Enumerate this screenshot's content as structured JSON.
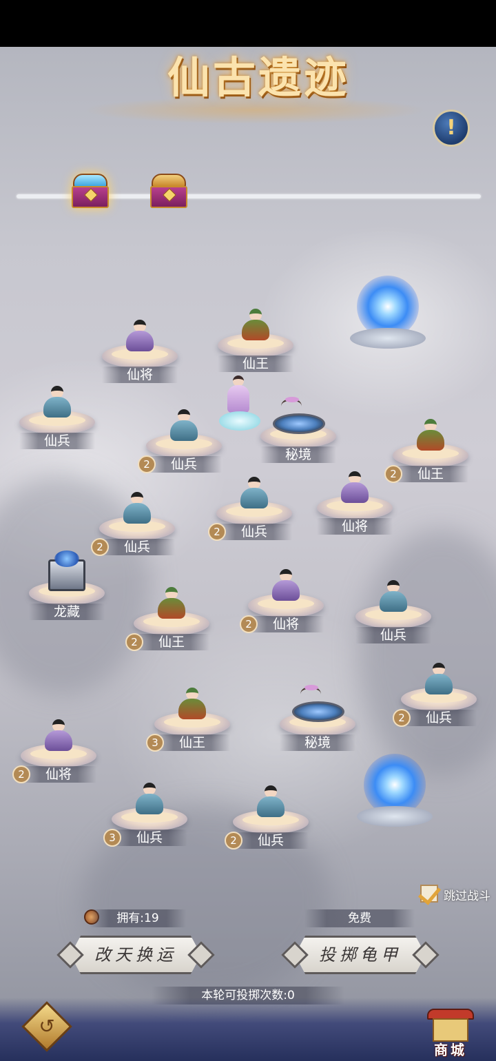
{
  "header": {
    "title": "仙古遗迹",
    "info_icon": "!",
    "chests": [
      {
        "name": "chest-1",
        "state": "glowing"
      },
      {
        "name": "chest-2",
        "state": "closed"
      }
    ]
  },
  "board": {
    "nodes": [
      {
        "label": "仙将",
        "count": "",
        "kind": "purple"
      },
      {
        "label": "仙王",
        "count": "",
        "kind": "king"
      },
      {
        "label": "仙兵",
        "count": "",
        "kind": "blue"
      },
      {
        "label": "仙兵",
        "count": "2",
        "kind": "blue"
      },
      {
        "label": "秘境",
        "count": "",
        "kind": "secret"
      },
      {
        "label": "仙王",
        "count": "2",
        "kind": "king"
      },
      {
        "label": "仙兵",
        "count": "2",
        "kind": "blue"
      },
      {
        "label": "仙将",
        "count": "",
        "kind": "purple"
      },
      {
        "label": "仙兵",
        "count": "2",
        "kind": "blue"
      },
      {
        "label": "龙藏",
        "count": "",
        "kind": "treasure"
      },
      {
        "label": "仙将",
        "count": "2",
        "kind": "purple"
      },
      {
        "label": "仙兵",
        "count": "",
        "kind": "blue"
      },
      {
        "label": "仙王",
        "count": "2",
        "kind": "king"
      },
      {
        "label": "仙兵",
        "count": "2",
        "kind": "blue"
      },
      {
        "label": "仙王",
        "count": "3",
        "kind": "king"
      },
      {
        "label": "秘境",
        "count": "",
        "kind": "secret"
      },
      {
        "label": "仙将",
        "count": "2",
        "kind": "purple"
      },
      {
        "label": "仙兵",
        "count": "3",
        "kind": "blue"
      },
      {
        "label": "仙兵",
        "count": "2",
        "kind": "blue"
      }
    ],
    "portals": [
      "portal-top",
      "portal-bottom"
    ]
  },
  "controls": {
    "skip_battle_label": "跳过战斗",
    "skip_battle_checked": true,
    "owned_label": "拥有:19",
    "free_label": "免费",
    "change_fate_button": "改天换运",
    "throw_turtle_button": "投掷龟甲",
    "throws_left_label": "本轮可投掷次数:0",
    "shop_label": "商城"
  },
  "colors": {
    "accent_gold": "#b38a55",
    "portal_blue": "#3c8cf5",
    "title_gold": "#fbe3ae"
  }
}
